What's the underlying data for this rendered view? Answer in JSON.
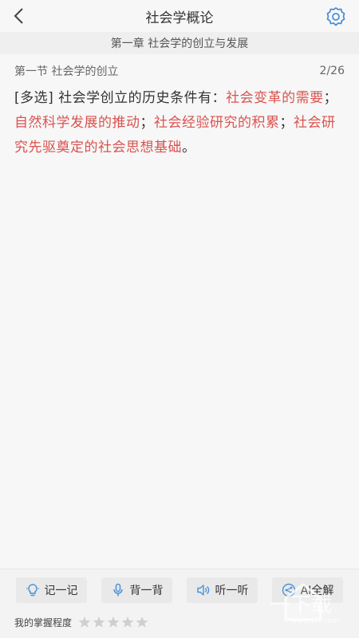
{
  "header": {
    "title": "社会学概论"
  },
  "chapter": "第一章 社会学的创立与发展",
  "section": {
    "name": "第一节 社会学的创立",
    "progress": "2/26"
  },
  "question": {
    "type_tag": "[多选]",
    "stem": " 社会学创立的历史条件有：",
    "answers": [
      "社会变革的需要",
      "自然科学发展的推动",
      "社会经验研究的积累",
      "社会研究先驱奠定的社会思想基础"
    ],
    "separator": "；",
    "end": "。"
  },
  "toolbar": {
    "buttons": [
      {
        "label": "记一记",
        "icon": "lightbulb-icon"
      },
      {
        "label": "背一背",
        "icon": "microphone-icon"
      },
      {
        "label": "听一听",
        "icon": "speaker-icon"
      },
      {
        "label": "AI全解",
        "icon": "ai-icon"
      }
    ]
  },
  "mastery": {
    "label": "我的掌握程度",
    "rating": 0,
    "max": 5
  },
  "watermark": {
    "text": "一下载",
    "url": "www.yi4.com"
  },
  "colors": {
    "answer": "#d9534f",
    "icon_blue": "#4a90d9"
  }
}
